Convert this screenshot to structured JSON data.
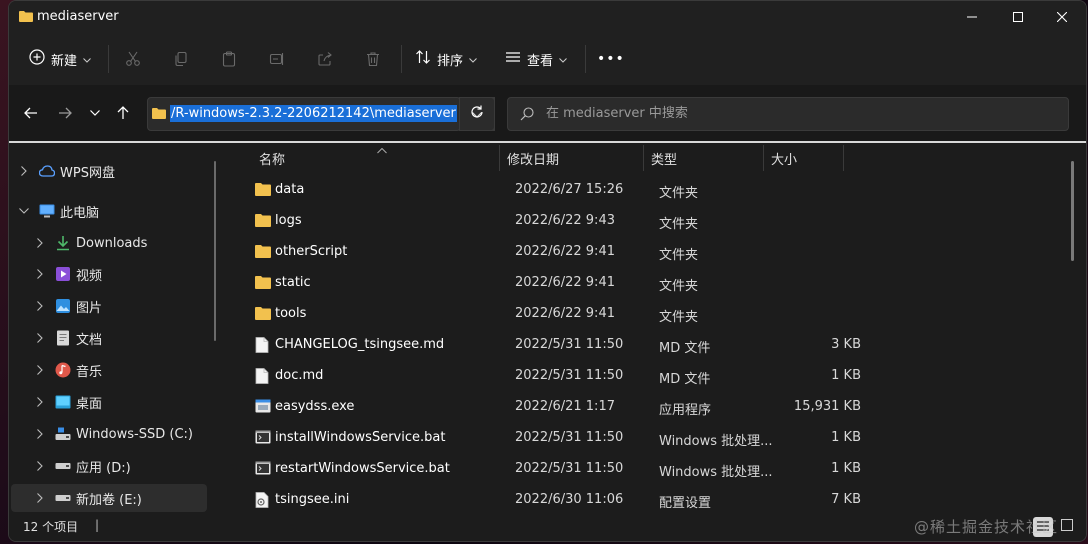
{
  "window": {
    "title": "mediaserver"
  },
  "toolbar": {
    "new_label": "新建",
    "sort_label": "排序",
    "view_label": "查看",
    "more_label": "•••"
  },
  "address": {
    "path": "/R-windows-2.3.2-2206212142\\mediaserver",
    "search_placeholder": "在 mediaserver 中搜索"
  },
  "sidebar": {
    "items": [
      {
        "label": "WPS网盘",
        "icon": "cloud-icon"
      },
      {
        "label": "此电脑",
        "icon": "computer-icon"
      },
      {
        "label": "Downloads",
        "icon": "download-icon"
      },
      {
        "label": "视频",
        "icon": "video-icon"
      },
      {
        "label": "图片",
        "icon": "picture-icon"
      },
      {
        "label": "文档",
        "icon": "document-icon"
      },
      {
        "label": "音乐",
        "icon": "music-icon"
      },
      {
        "label": "桌面",
        "icon": "desktop-icon"
      },
      {
        "label": "Windows-SSD (C:)",
        "icon": "drive-icon"
      },
      {
        "label": "应用 (D:)",
        "icon": "drive-icon"
      },
      {
        "label": "新加卷 (E:)",
        "icon": "drive-icon"
      }
    ]
  },
  "columns": {
    "name": "名称",
    "date": "修改日期",
    "type": "类型",
    "size": "大小"
  },
  "files": [
    {
      "name": "data",
      "date": "2022/6/27 15:26",
      "type": "文件夹",
      "size": "",
      "icon": "folder-icon"
    },
    {
      "name": "logs",
      "date": "2022/6/22 9:43",
      "type": "文件夹",
      "size": "",
      "icon": "folder-icon"
    },
    {
      "name": "otherScript",
      "date": "2022/6/22 9:41",
      "type": "文件夹",
      "size": "",
      "icon": "folder-icon"
    },
    {
      "name": "static",
      "date": "2022/6/22 9:41",
      "type": "文件夹",
      "size": "",
      "icon": "folder-icon"
    },
    {
      "name": "tools",
      "date": "2022/6/22 9:41",
      "type": "文件夹",
      "size": "",
      "icon": "folder-icon"
    },
    {
      "name": "CHANGELOG_tsingsee.md",
      "date": "2022/5/31 11:50",
      "type": "MD 文件",
      "size": "3 KB",
      "icon": "file-icon"
    },
    {
      "name": "doc.md",
      "date": "2022/5/31 11:50",
      "type": "MD 文件",
      "size": "1 KB",
      "icon": "file-icon"
    },
    {
      "name": "easydss.exe",
      "date": "2022/6/21 1:17",
      "type": "应用程序",
      "size": "15,931 KB",
      "icon": "exe-icon"
    },
    {
      "name": "installWindowsService.bat",
      "date": "2022/5/31 11:50",
      "type": "Windows 批处理...",
      "size": "1 KB",
      "icon": "bat-icon"
    },
    {
      "name": "restartWindowsService.bat",
      "date": "2022/5/31 11:50",
      "type": "Windows 批处理...",
      "size": "1 KB",
      "icon": "bat-icon"
    },
    {
      "name": "tsingsee.ini",
      "date": "2022/6/30 11:06",
      "type": "配置设置",
      "size": "7 KB",
      "icon": "ini-icon"
    }
  ],
  "status": {
    "item_count": "12 个项目",
    "cursor": "|"
  },
  "watermark": "@稀土掘金技术社区",
  "colors": {
    "accent": "#1a6fd8",
    "folder": "#f2c14e",
    "bg": "#1c1c1c"
  }
}
